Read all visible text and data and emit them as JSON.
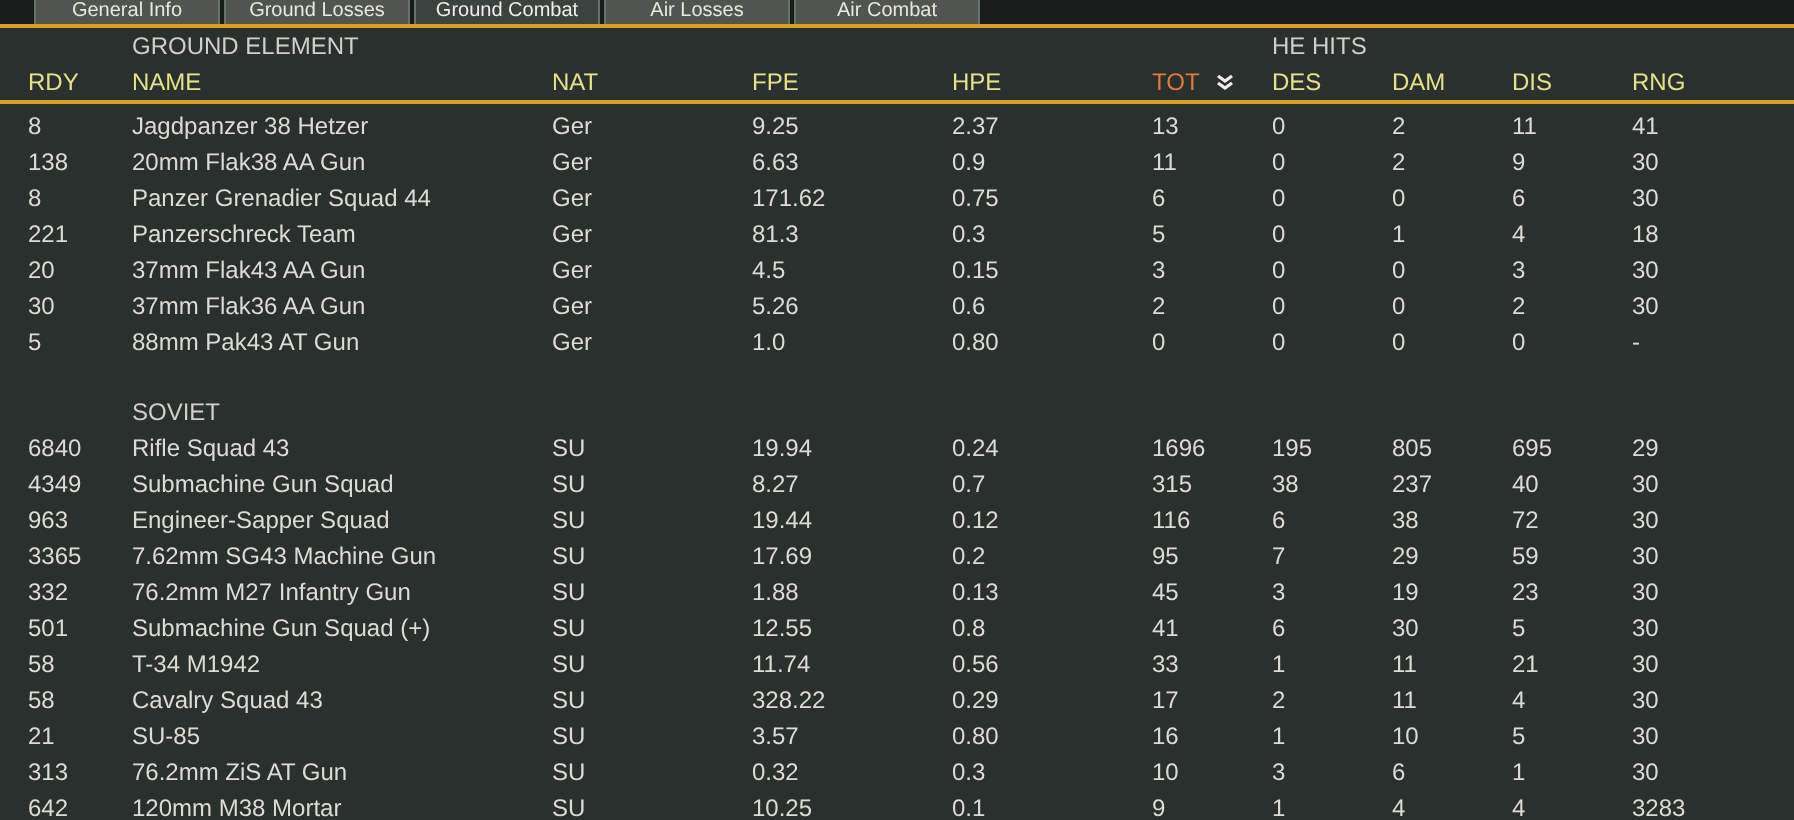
{
  "tabs": [
    {
      "label": "General Info",
      "selected": false
    },
    {
      "label": "Ground Losses",
      "selected": false
    },
    {
      "label": "Ground Combat",
      "selected": true
    },
    {
      "label": "Air Losses",
      "selected": false
    },
    {
      "label": "Air Combat",
      "selected": false
    }
  ],
  "columns": [
    {
      "label": "RDY",
      "sorted": false
    },
    {
      "group": "GROUND ELEMENT",
      "label": "NAME",
      "sorted": false
    },
    {
      "label": "NAT",
      "sorted": false
    },
    {
      "label": "FPE",
      "sorted": false
    },
    {
      "label": "HPE",
      "sorted": false
    },
    {
      "label": "TOT",
      "sorted": true
    },
    {
      "group": "HE HITS",
      "label": "DES",
      "sorted": false
    },
    {
      "label": "DAM",
      "sorted": false
    },
    {
      "label": "DIS",
      "sorted": false
    },
    {
      "label": "RNG",
      "sorted": false
    }
  ],
  "sections": [
    {
      "rows": [
        [
          "8",
          "Jagdpanzer 38 Hetzer",
          "Ger",
          "9.25",
          "2.37",
          "13",
          "0",
          "2",
          "11",
          "41"
        ],
        [
          "138",
          "20mm Flak38 AA Gun",
          "Ger",
          "6.63",
          "0.9",
          "11",
          "0",
          "2",
          "9",
          "30"
        ],
        [
          "8",
          "Panzer Grenadier Squad 44",
          "Ger",
          "171.62",
          "0.75",
          "6",
          "0",
          "0",
          "6",
          "30"
        ],
        [
          "221",
          "Panzerschreck Team",
          "Ger",
          "81.3",
          "0.3",
          "5",
          "0",
          "1",
          "4",
          "18"
        ],
        [
          "20",
          "37mm Flak43 AA Gun",
          "Ger",
          "4.5",
          "0.15",
          "3",
          "0",
          "0",
          "3",
          "30"
        ],
        [
          "30",
          "37mm Flak36 AA Gun",
          "Ger",
          "5.26",
          "0.6",
          "2",
          "0",
          "0",
          "2",
          "30"
        ],
        [
          "5",
          "88mm Pak43 AT Gun",
          "Ger",
          "1.0",
          "0.80",
          "0",
          "0",
          "0",
          "0",
          "-"
        ]
      ]
    },
    {
      "title": "SOVIET",
      "rows": [
        [
          "6840",
          "Rifle Squad 43",
          "SU",
          "19.94",
          "0.24",
          "1696",
          "195",
          "805",
          "695",
          "29"
        ],
        [
          "4349",
          "Submachine Gun Squad",
          "SU",
          "8.27",
          "0.7",
          "315",
          "38",
          "237",
          "40",
          "30"
        ],
        [
          "963",
          "Engineer-Sapper Squad",
          "SU",
          "19.44",
          "0.12",
          "116",
          "6",
          "38",
          "72",
          "30"
        ],
        [
          "3365",
          "7.62mm SG43 Machine Gun",
          "SU",
          "17.69",
          "0.2",
          "95",
          "7",
          "29",
          "59",
          "30"
        ],
        [
          "332",
          "76.2mm M27 Infantry Gun",
          "SU",
          "1.88",
          "0.13",
          "45",
          "3",
          "19",
          "23",
          "30"
        ],
        [
          "501",
          "Submachine Gun Squad (+)",
          "SU",
          "12.55",
          "0.8",
          "41",
          "6",
          "30",
          "5",
          "30"
        ],
        [
          "58",
          "T-34 M1942",
          "SU",
          "11.74",
          "0.56",
          "33",
          "1",
          "11",
          "21",
          "30"
        ],
        [
          "58",
          "Cavalry Squad 43",
          "SU",
          "328.22",
          "0.29",
          "17",
          "2",
          "11",
          "4",
          "30"
        ],
        [
          "21",
          "SU-85",
          "SU",
          "3.57",
          "0.80",
          "16",
          "1",
          "10",
          "5",
          "30"
        ],
        [
          "313",
          "76.2mm ZiS AT Gun",
          "SU",
          "0.32",
          "0.3",
          "10",
          "3",
          "6",
          "1",
          "30"
        ],
        [
          "642",
          "120mm M38 Mortar",
          "SU",
          "10.25",
          "0.1",
          "9",
          "1",
          "4",
          "4",
          "3283"
        ]
      ]
    }
  ]
}
